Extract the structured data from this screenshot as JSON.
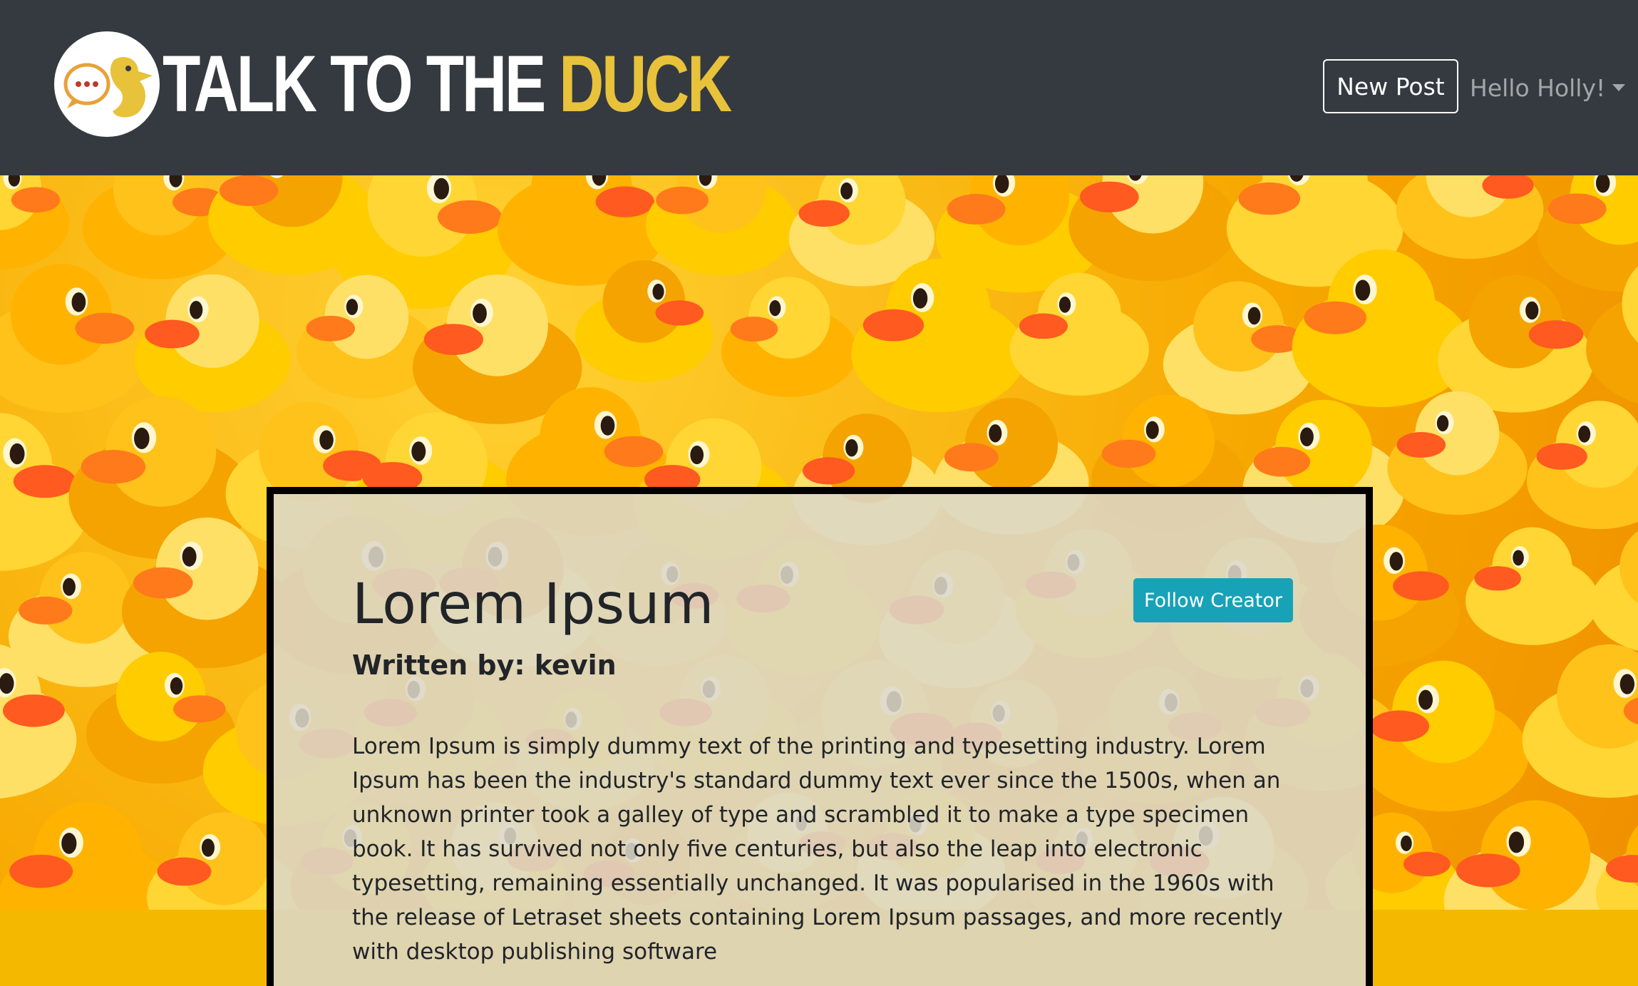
{
  "navbar": {
    "brand_white": "TALK TO THE ",
    "brand_yellow": "DUCK",
    "new_post_label": "New Post",
    "user_greeting": "Hello Holly!"
  },
  "post": {
    "title": "Lorem Ipsum",
    "byline": "Written by: kevin",
    "follow_label": "Follow Creator",
    "body": "Lorem Ipsum is simply dummy text of the printing and typesetting industry. Lorem Ipsum has been the industry's standard dummy text ever since the 1500s, when an unknown printer took a galley of type and scrambled it to make a type specimen book. It has survived not only five centuries, but also the leap into electronic typesetting, remaining essentially unchanged. It was popularised in the 1960s with the release of Letraset sheets containing Lorem Ipsum passages, and more recently with desktop publishing software"
  },
  "colors": {
    "navbar_bg": "#343a40",
    "brand_accent": "#e8c23a",
    "follow_button": "#17a2b8"
  },
  "icons": {
    "logo": "duck-speech-bubble-logo",
    "dropdown": "caret-down-icon"
  }
}
